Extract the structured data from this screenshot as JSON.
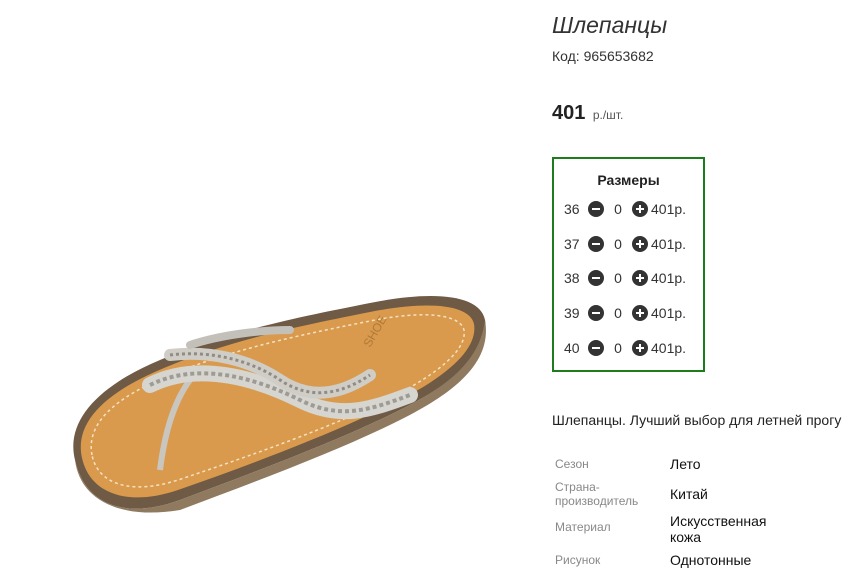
{
  "product": {
    "title": "Шлепанцы",
    "code_label": "Код:",
    "code_value": "965653682",
    "price_value": "401",
    "price_unit": "р./шт."
  },
  "sizes": {
    "heading": "Размеры",
    "rows": [
      {
        "size": "36",
        "qty": "0",
        "sum": "401р."
      },
      {
        "size": "37",
        "qty": "0",
        "sum": "401р."
      },
      {
        "size": "38",
        "qty": "0",
        "sum": "401р."
      },
      {
        "size": "39",
        "qty": "0",
        "sum": "401р."
      },
      {
        "size": "40",
        "qty": "0",
        "sum": "401р."
      }
    ]
  },
  "description": "Шлепанцы. Лучший выбор для летней прогу",
  "properties": [
    {
      "label": "Сезон",
      "value": "Лето"
    },
    {
      "label": "Страна-производитель",
      "value": "Китай"
    },
    {
      "label": "Материал",
      "value": "Искусственная кожа"
    },
    {
      "label": "Рисунок",
      "value": "Однотонные"
    }
  ],
  "icons": {
    "minus": "minus-circle-icon",
    "plus": "plus-circle-icon"
  },
  "colors": {
    "sizes_border": "#1d7d1d"
  }
}
